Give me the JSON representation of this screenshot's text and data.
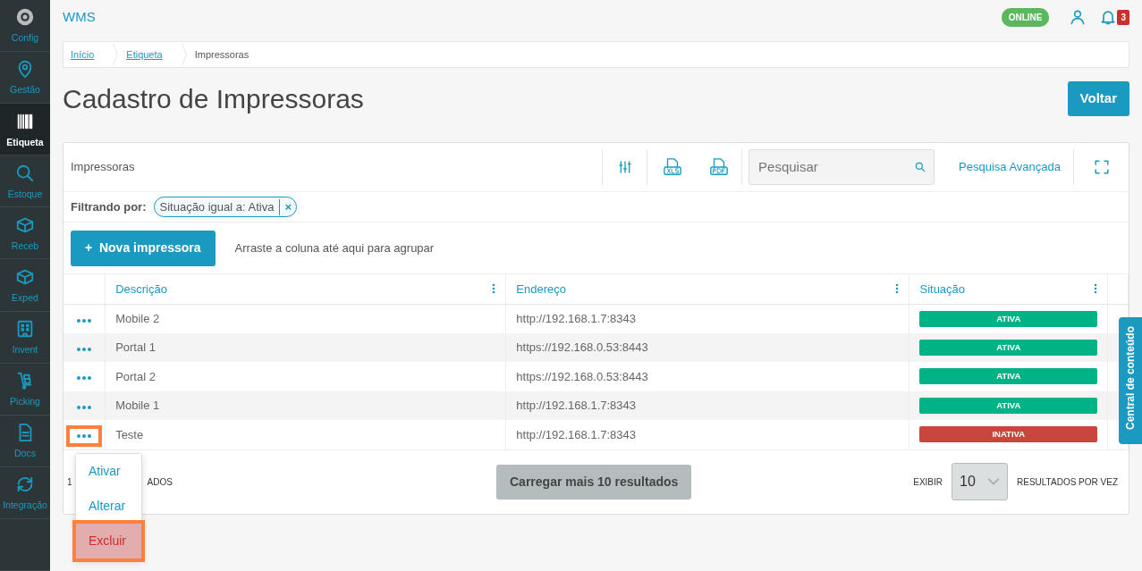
{
  "sidebar": {
    "items": [
      {
        "label": "Config",
        "selected": false
      },
      {
        "label": "Gestão",
        "selected": false
      },
      {
        "label": "Etiqueta",
        "selected": true
      },
      {
        "label": "Estoque",
        "selected": false
      },
      {
        "label": "Receb",
        "selected": false
      },
      {
        "label": "Exped",
        "selected": false
      },
      {
        "label": "Invent",
        "selected": false
      },
      {
        "label": "Picking",
        "selected": false
      },
      {
        "label": "Docs",
        "selected": false
      },
      {
        "label": "Integração",
        "selected": false
      }
    ]
  },
  "header": {
    "app_name": "WMS",
    "status_badge": "ONLINE",
    "notification_count": "3"
  },
  "breadcrumb": [
    "Início",
    "Etiqueta",
    "Impressoras"
  ],
  "page_title": "Cadastro de Impressoras",
  "back_button": "Voltar",
  "panel": {
    "title": "Impressoras",
    "search": {
      "placeholder": "Pesquisar"
    },
    "advanced_search": "Pesquisa Avançada",
    "filter_label": "Filtrando por:",
    "filter_chip": "Situação igual a: Ativa",
    "filter_remove": "×",
    "new_button": {
      "icon": "+",
      "label": "Nova impressora"
    },
    "group_hint": "Arraste a coluna até aqui para agrupar",
    "columns": [
      "Descrição",
      "Endereço",
      "Situação"
    ],
    "rows": [
      {
        "description": "Mobile 2",
        "address": "http://192.168.1.7:8343",
        "status": "ATIVA",
        "kind": "active",
        "highlighted": false
      },
      {
        "description": "Portal 1",
        "address": "https://192.168.0.53:8443",
        "status": "ATIVA",
        "kind": "active",
        "highlighted": false
      },
      {
        "description": "Portal 2",
        "address": "https://192.168.0.53:8443",
        "status": "ATIVA",
        "kind": "active",
        "highlighted": false
      },
      {
        "description": "Mobile 1",
        "address": "http://192.168.1.7:8343",
        "status": "ATIVA",
        "kind": "active",
        "highlighted": false
      },
      {
        "description": "Teste",
        "address": "http://192.168.1.7:8343",
        "status": "INATIVA",
        "kind": "inactive",
        "highlighted": true
      }
    ],
    "action_menu": [
      {
        "label": "Ativar",
        "kind": "normal",
        "highlighted": false
      },
      {
        "label": "Alterar",
        "kind": "normal",
        "highlighted": false
      },
      {
        "label": "Excluir",
        "kind": "danger",
        "highlighted": true
      }
    ],
    "footer": {
      "count_start": "1",
      "count_end": "ADOS",
      "load_more": "Carregar mais 10 resultados",
      "page_size_label": "EXIBIR",
      "page_size": "10",
      "page_size_suffix": "RESULTADOS POR VEZ"
    }
  },
  "side_tab": "Central de conteúdo"
}
